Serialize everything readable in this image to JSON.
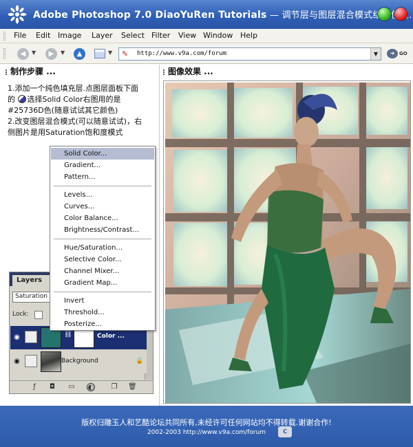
{
  "window": {
    "title_main": "Adobe Photoshop 7.0  DiaoYuRen Tutorials",
    "title_sub": " — 调节层与图层混合模式结合使用..."
  },
  "menubar": {
    "items": [
      "File",
      "Edit",
      "Image",
      "Layer",
      "Select",
      "Filter",
      "View",
      "Window",
      "Help"
    ]
  },
  "address": {
    "url": "http://www.v9a.com/forum",
    "go_label": "GO"
  },
  "panels": {
    "left_title": "制作步骤 ...",
    "right_title": "图像效果 ..."
  },
  "steps": {
    "line1": "1.添加一个纯色填充层.点图层面板下面",
    "line2a": "的",
    "line2b": "选择Solid Color右图用的是",
    "line3": "#25736D色(随意试试其它颜色)",
    "line4": "2.改变图层混合模式(可以随意试试)，右",
    "line5": "侧图片是用Saturation饱和度模式"
  },
  "layers_panel": {
    "tab_label": "Layers",
    "blend_mode": "Saturation",
    "lock_label": "Lock:",
    "color_layer_name": "Color ...",
    "background_layer_name": "Background",
    "fill_color": "#25736d"
  },
  "context_menu": {
    "group1": [
      "Solid Color...",
      "Gradient...",
      "Pattern..."
    ],
    "group2": [
      "Levels...",
      "Curves...",
      "Color Balance...",
      "Brightness/Contrast..."
    ],
    "group3": [
      "Hue/Saturation...",
      "Selective Color...",
      "Channel Mixer...",
      "Gradient Map..."
    ],
    "group4": [
      "Invert",
      "Threshold...",
      "Posterize..."
    ],
    "selected": "Solid Color..."
  },
  "footer": {
    "line1": "版权归雕玉人和艺酷论坛共同所有,未经许可任何网站均不得转载.谢谢合作!",
    "line2": "2002-2003 http://www.v9a.com/forum"
  }
}
